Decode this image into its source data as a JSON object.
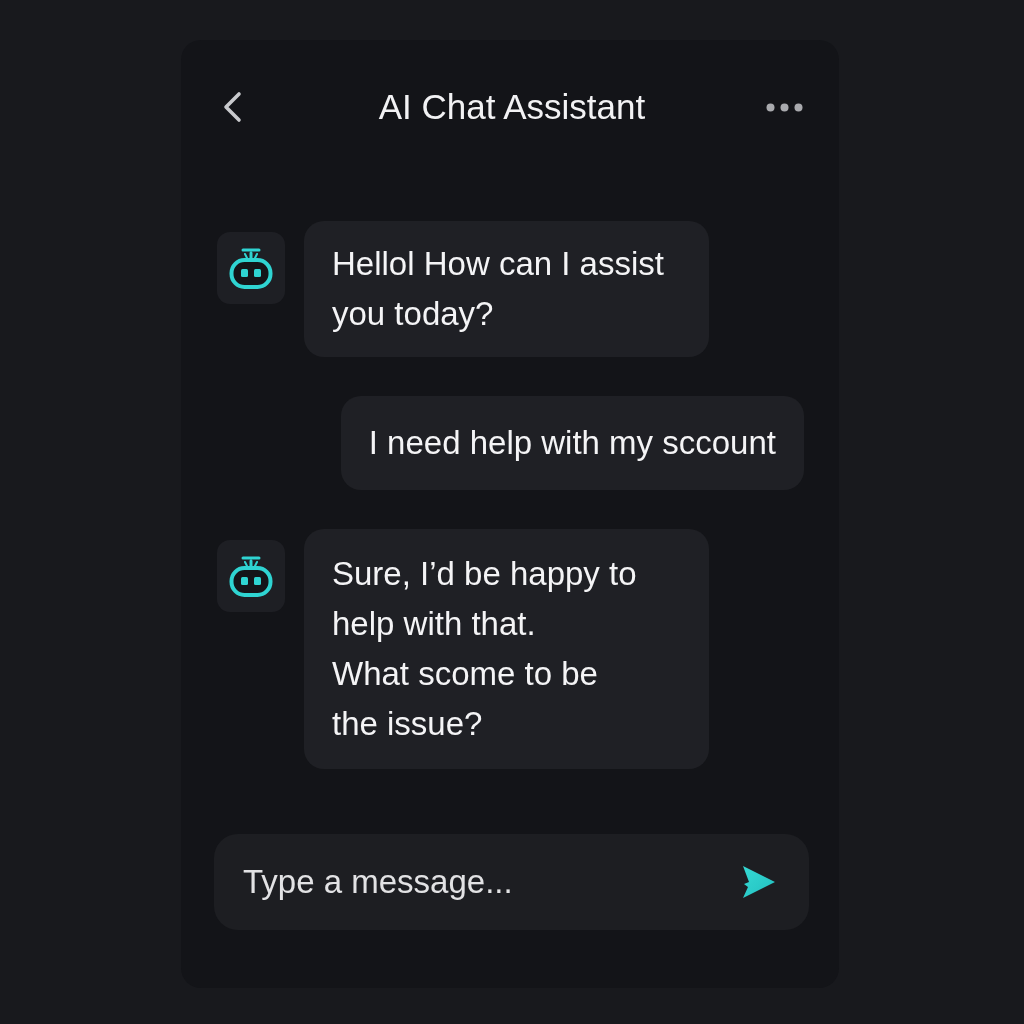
{
  "header": {
    "title": "AI Chat Assistant"
  },
  "messages": [
    {
      "kind": "bot",
      "text": "Hellol How can I assist\nyou today?"
    },
    {
      "kind": "user",
      "text": "I need help with my sccount"
    },
    {
      "kind": "bot",
      "text": "Sure, I’d be happy to\nhelp with that.\nWhat scome to be\nthe issue?"
    }
  ],
  "composer": {
    "placeholder": "Type a message..."
  }
}
